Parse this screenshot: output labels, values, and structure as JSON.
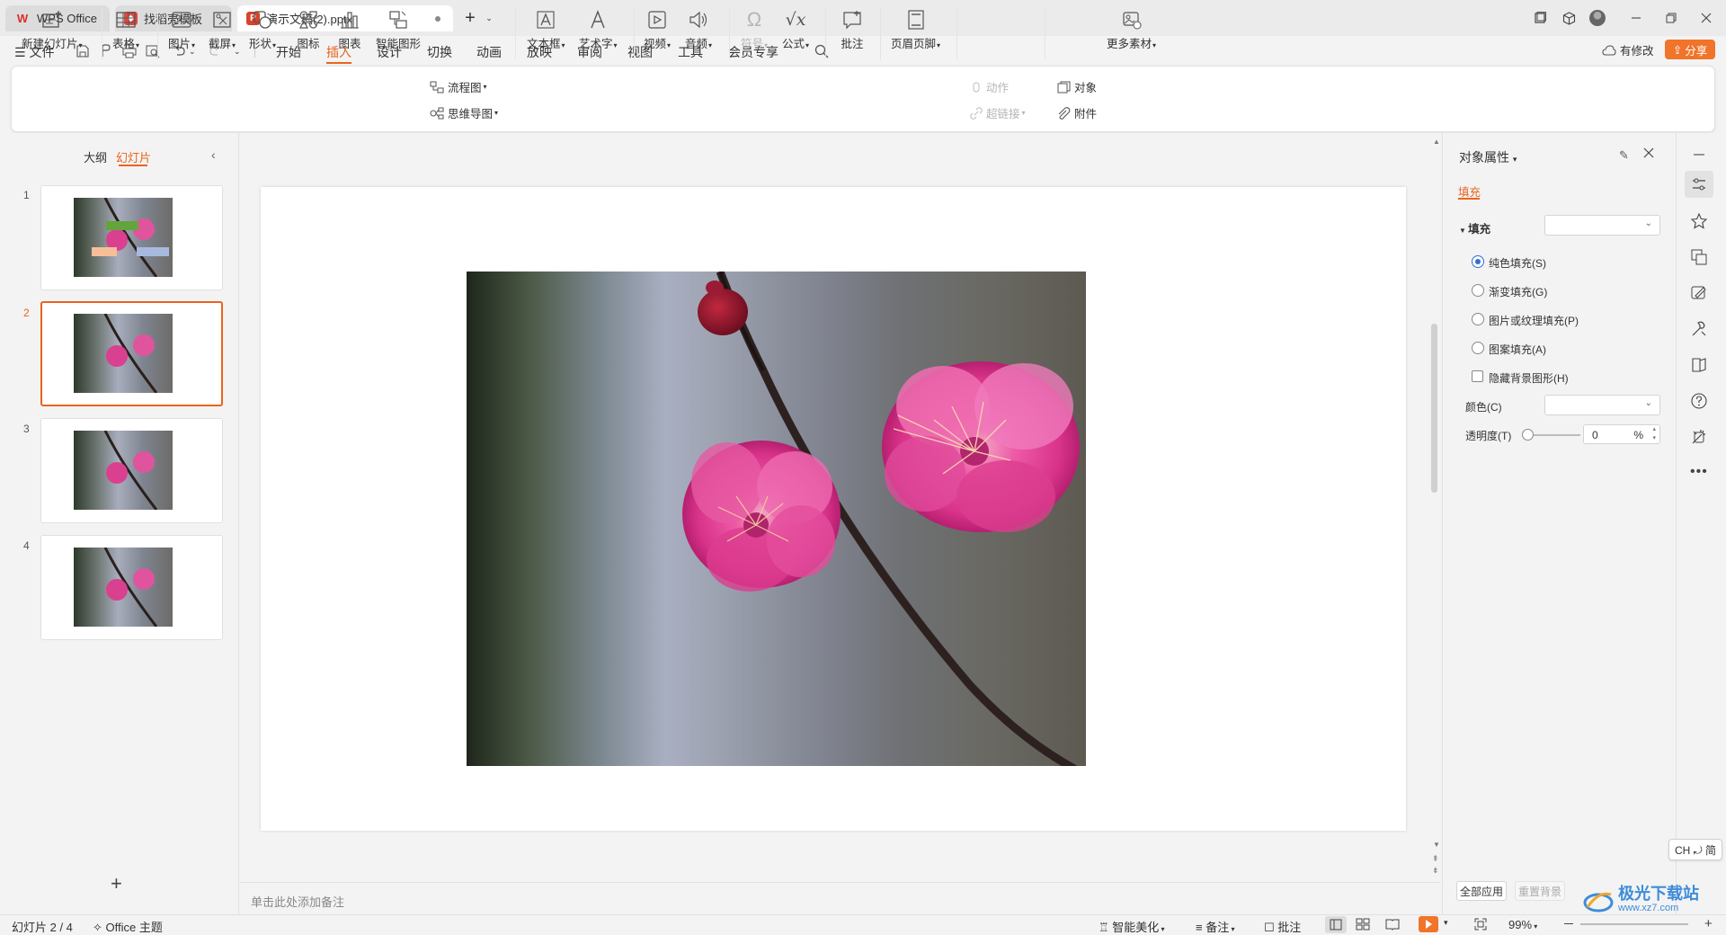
{
  "tabs": [
    {
      "label": "WPS Office"
    },
    {
      "label": "找稻壳模板"
    },
    {
      "label": "演示文稿(2).pptx"
    }
  ],
  "menubar": {
    "file": "文件",
    "items": [
      "开始",
      "插入",
      "设计",
      "切换",
      "动画",
      "放映",
      "审阅",
      "视图",
      "工具",
      "会员专享"
    ],
    "active": "插入",
    "has_changes": "有修改",
    "share": "分享"
  },
  "ribbon": {
    "new_slide": "新建幻灯片",
    "table": "表格",
    "picture": "图片",
    "screenshot": "截屏",
    "shape": "形状",
    "icon": "图标",
    "chart": "图表",
    "smart_graphic": "智能图形",
    "flowchart": "流程图",
    "mindmap": "思维导图",
    "textbox": "文本框",
    "wordart": "艺术字",
    "video": "视频",
    "audio": "音频",
    "symbol": "符号",
    "formula": "公式",
    "comment": "批注",
    "header_footer": "页眉页脚",
    "action": "动作",
    "hyperlink": "超链接",
    "object": "对象",
    "attachment": "附件",
    "more_material": "更多素材"
  },
  "left_panel": {
    "outline_tab": "大纲",
    "slides_tab": "幻灯片",
    "slides": [
      {
        "num": "1"
      },
      {
        "num": "2"
      },
      {
        "num": "3"
      },
      {
        "num": "4"
      }
    ],
    "selected": 2,
    "add": "+"
  },
  "notes": {
    "placeholder": "单击此处添加备注"
  },
  "properties": {
    "title": "对象属性",
    "tab_fill": "填充",
    "fill_section": "填充",
    "options": [
      "纯色填充(S)",
      "渐变填充(G)",
      "图片或纹理填充(P)",
      "图案填充(A)"
    ],
    "selected_option": "纯色填充(S)",
    "hide_bg": "隐藏背景图形(H)",
    "color_label": "颜色(C)",
    "transparency_label": "透明度(T)",
    "transparency_value": "0",
    "percent": "%",
    "apply_all": "全部应用",
    "reset_bg": "重置背景"
  },
  "ime": "CH ⤾ 简",
  "status": {
    "slide_info": "幻灯片 2 / 4",
    "theme": "Office 主题",
    "beautify": "智能美化",
    "notes": "备注",
    "comments": "批注",
    "zoom": "99%"
  },
  "watermark": {
    "text": "极光下载站",
    "url": "www.xz7.com"
  },
  "colors": {
    "accent": "#e8641f",
    "wps_red": "#d7312b",
    "share_bg": "#f0742a"
  }
}
